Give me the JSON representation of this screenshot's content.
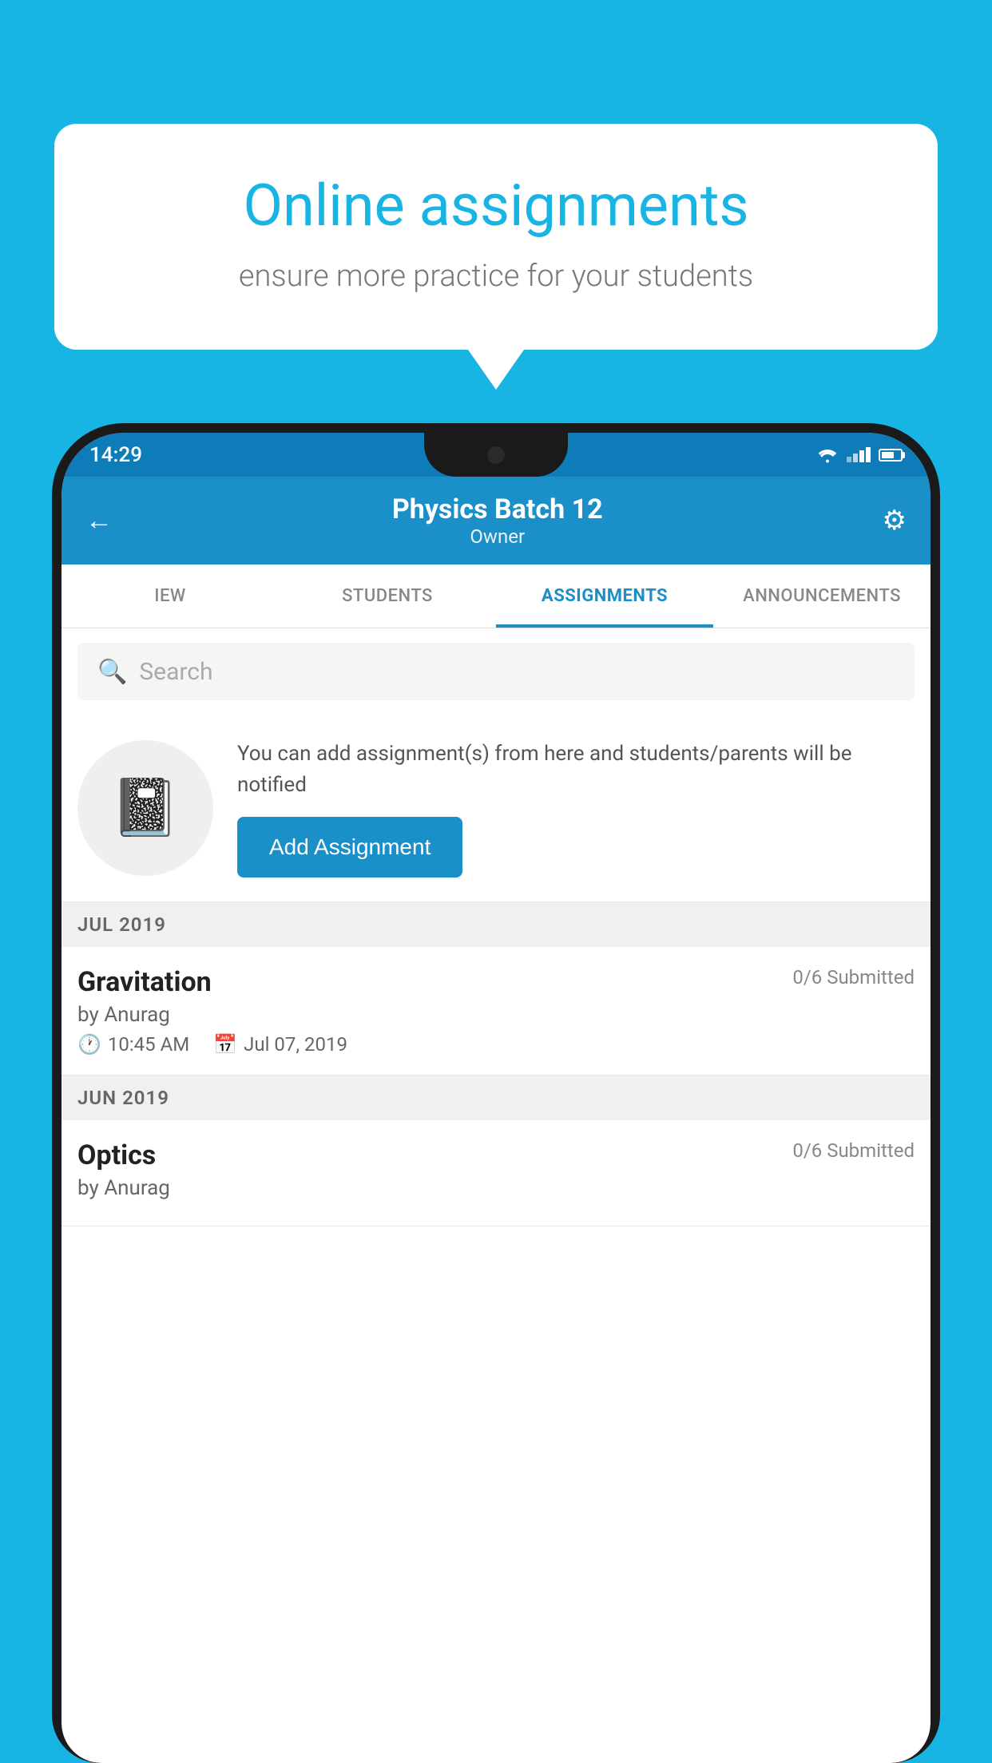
{
  "background": {
    "color": "#18b4e4"
  },
  "speech_bubble": {
    "title": "Online assignments",
    "subtitle": "ensure more practice for your students"
  },
  "status_bar": {
    "time": "14:29"
  },
  "app_header": {
    "title": "Physics Batch 12",
    "subtitle": "Owner",
    "back_label": "←",
    "settings_label": "⚙"
  },
  "tabs": [
    {
      "label": "IEW",
      "active": false
    },
    {
      "label": "STUDENTS",
      "active": false
    },
    {
      "label": "ASSIGNMENTS",
      "active": true
    },
    {
      "label": "ANNOUNCEMENTS",
      "active": false
    }
  ],
  "search": {
    "placeholder": "Search"
  },
  "add_assignment": {
    "description": "You can add assignment(s) from here and students/parents will be notified",
    "button_label": "Add Assignment"
  },
  "sections": [
    {
      "label": "JUL 2019",
      "assignments": [
        {
          "name": "Gravitation",
          "submitted": "0/6 Submitted",
          "author": "by Anurag",
          "time": "10:45 AM",
          "date": "Jul 07, 2019"
        }
      ]
    },
    {
      "label": "JUN 2019",
      "assignments": [
        {
          "name": "Optics",
          "submitted": "0/6 Submitted",
          "author": "by Anurag",
          "time": "",
          "date": ""
        }
      ]
    }
  ]
}
